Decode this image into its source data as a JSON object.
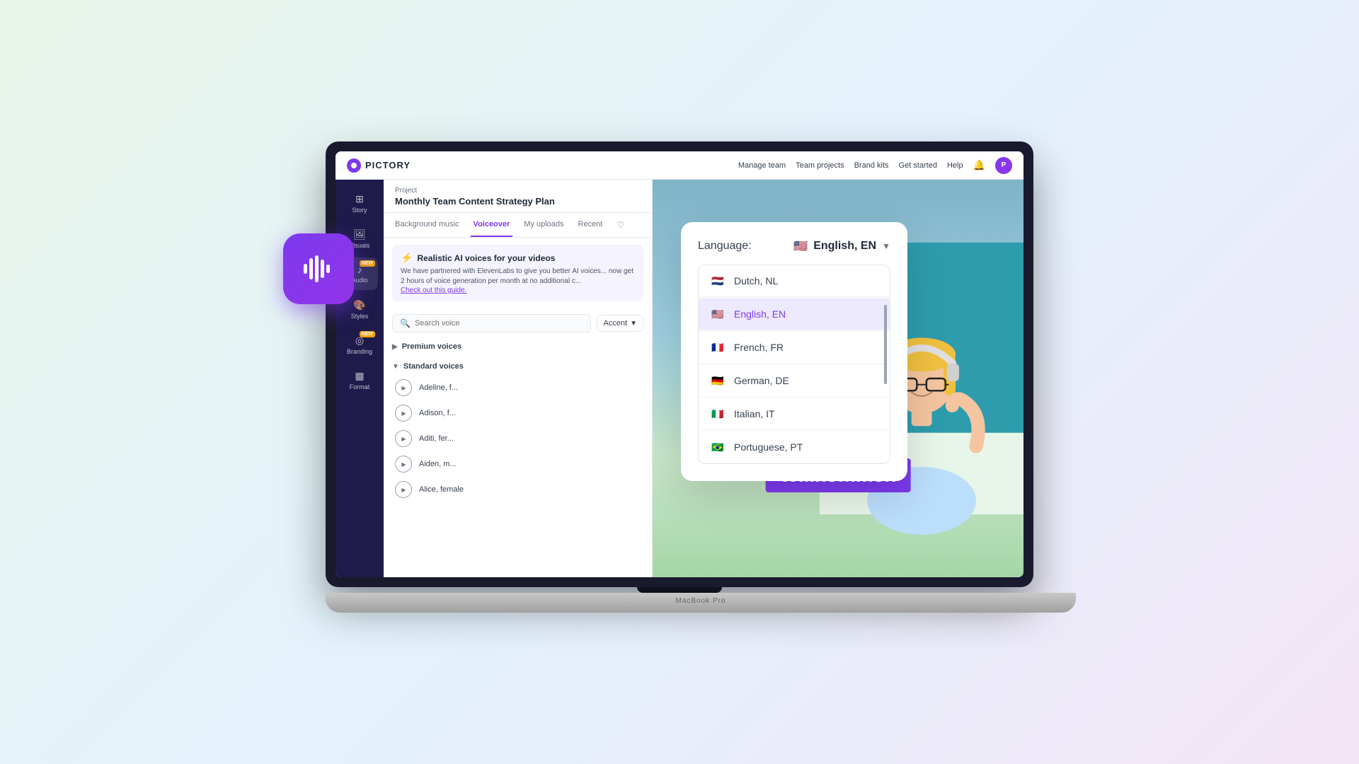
{
  "app": {
    "name": "PICTORY",
    "logo_alt": "Pictory logo"
  },
  "nav": {
    "manage_team": "Manage team",
    "team_projects": "Team projects",
    "brand_kits": "Brand kits",
    "get_started": "Get started",
    "help": "Help",
    "avatar_initials": "P"
  },
  "sidebar": {
    "items": [
      {
        "label": "Story",
        "icon": "grid"
      },
      {
        "label": "Visuals",
        "icon": "image"
      },
      {
        "label": "Audio",
        "icon": "music",
        "badge": "NEW"
      },
      {
        "label": "Styles",
        "icon": "palette"
      },
      {
        "label": "Branding",
        "icon": "branding",
        "badge": "NEW"
      },
      {
        "label": "Format",
        "icon": "format"
      }
    ]
  },
  "project": {
    "label": "Project",
    "title": "Monthly Team Content Strategy Plan"
  },
  "tabs": {
    "items": [
      {
        "label": "Background music",
        "active": false
      },
      {
        "label": "Voiceover",
        "active": true
      },
      {
        "label": "My uploads",
        "active": false
      },
      {
        "label": "Recent",
        "active": false
      }
    ]
  },
  "ai_banner": {
    "icon": "⚡",
    "title": "Realistic AI voices for your videos",
    "text": "We have partnered with ElevenLabs to give you better AI voices... now get 2 hours of voice generation per month at no additional c...",
    "link": "Check out this guide."
  },
  "search": {
    "placeholder": "Search voice",
    "accent_label": "Accent"
  },
  "voice_sections": {
    "premium": {
      "label": "Premium voices",
      "collapsed": false
    },
    "standard": {
      "label": "Standard voices",
      "collapsed": false
    },
    "voices": [
      {
        "name": "Adeline, f..."
      },
      {
        "name": "Adison, f..."
      },
      {
        "name": "Aditi, fer..."
      },
      {
        "name": "Aiden, m..."
      },
      {
        "name": "Alice, female"
      }
    ]
  },
  "language_dropdown": {
    "label": "Language:",
    "selected": "English, EN",
    "options": [
      {
        "code": "NL",
        "label": "Dutch, NL",
        "flag": "🇳🇱",
        "selected": false
      },
      {
        "code": "EN",
        "label": "English, EN",
        "flag": "🇺🇸",
        "selected": true
      },
      {
        "code": "FR",
        "label": "French, FR",
        "flag": "🇫🇷",
        "selected": false
      },
      {
        "code": "DE",
        "label": "German, DE",
        "flag": "🇩🇪",
        "selected": false
      },
      {
        "code": "IT",
        "label": "Italian, IT",
        "flag": "🇮🇹",
        "selected": false
      },
      {
        "code": "PT",
        "label": "Portuguese, PT",
        "flag": "🇧🇷",
        "selected": false
      }
    ]
  },
  "video": {
    "overlay_text": "Willkommen"
  },
  "voiceover_icon": {
    "alt": "Voiceover audio icon"
  },
  "macbook_label": "MacBook Pro"
}
